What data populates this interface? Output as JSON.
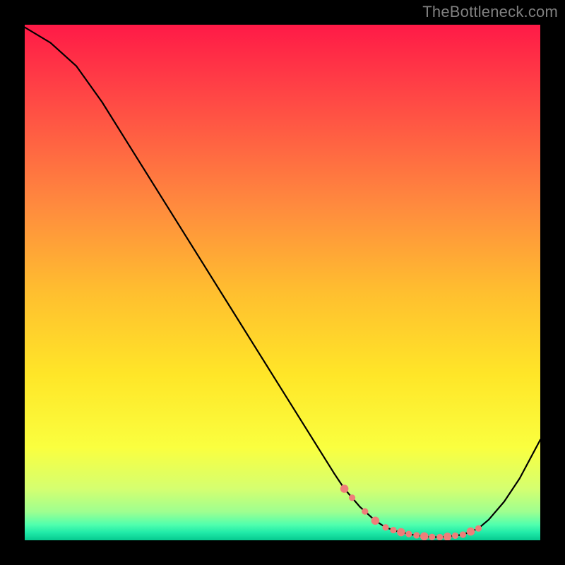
{
  "watermark": "TheBottleneck.com",
  "chart_data": {
    "type": "line",
    "title": "",
    "xlabel": "",
    "ylabel": "",
    "xlim": [
      0,
      100
    ],
    "ylim": [
      0,
      100
    ],
    "x": [
      0,
      5,
      10,
      15,
      20,
      25,
      30,
      35,
      40,
      45,
      50,
      55,
      60,
      62,
      65,
      68,
      70,
      72,
      75,
      78,
      80,
      82,
      85,
      88,
      90,
      93,
      96,
      100
    ],
    "values": [
      99.5,
      96.5,
      92,
      85,
      77,
      69,
      61,
      53,
      45,
      37,
      29,
      21,
      13,
      10,
      6.5,
      3.8,
      2.5,
      1.8,
      1.1,
      0.7,
      0.6,
      0.7,
      1.1,
      2.3,
      4.0,
      7.5,
      12,
      19.5
    ],
    "dotted_segment_x": [
      62,
      88
    ],
    "dot_color": "#ee7e7a",
    "line_color": "#000000",
    "gradient_stops": [
      {
        "offset": 0.0,
        "color": "#ff1a47"
      },
      {
        "offset": 0.15,
        "color": "#ff4a45"
      },
      {
        "offset": 0.35,
        "color": "#ff8a3e"
      },
      {
        "offset": 0.52,
        "color": "#ffbf2f"
      },
      {
        "offset": 0.68,
        "color": "#ffe628"
      },
      {
        "offset": 0.82,
        "color": "#faff3f"
      },
      {
        "offset": 0.9,
        "color": "#d5ff70"
      },
      {
        "offset": 0.945,
        "color": "#9eff90"
      },
      {
        "offset": 0.97,
        "color": "#4fffae"
      },
      {
        "offset": 0.985,
        "color": "#20eaa8"
      },
      {
        "offset": 1.0,
        "color": "#06c98f"
      }
    ]
  }
}
